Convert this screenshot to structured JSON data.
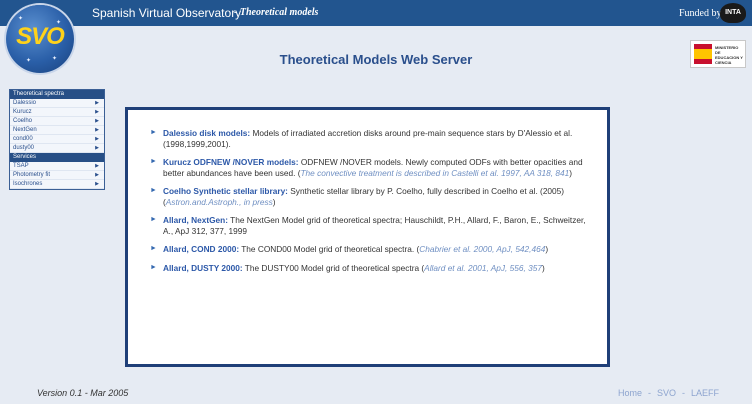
{
  "topbar": {
    "title": "Spanish Virtual Observatory",
    "subtitle": "- Theoretical models",
    "funded_by": "Funded by",
    "inta_logo": "INTA"
  },
  "logo": {
    "text": "SVO"
  },
  "header": {
    "title": "Theoretical Models Web Server"
  },
  "ministry_logo": {
    "text": "MINISTERIO DE EDUCACION Y CIENCIA"
  },
  "sidebar": {
    "sections": [
      {
        "title": "Theoretical spectra",
        "items": [
          {
            "label": "Dalessio",
            "arrow": "▶"
          },
          {
            "label": "Kurucz",
            "arrow": "▶"
          },
          {
            "label": "Coelho",
            "arrow": "▶"
          },
          {
            "label": "NextGen",
            "arrow": "▶"
          },
          {
            "label": "cond00",
            "arrow": "▶"
          },
          {
            "label": "dusty00",
            "arrow": "▶"
          }
        ]
      },
      {
        "title": "Services",
        "items": [
          {
            "label": "TSAP",
            "arrow": "▶"
          },
          {
            "label": "Photometry fit",
            "arrow": "▶"
          },
          {
            "label": "Isochrones",
            "arrow": "▶"
          }
        ]
      }
    ]
  },
  "entries": [
    {
      "title": "Dalessio disk models:",
      "text": " Models of irradiated accretion disks around pre-main sequence stars by D'Alessio et al. (1998,1999,2001).",
      "ref": "",
      "tail": ""
    },
    {
      "title": "Kurucz ODFNEW /NOVER models:",
      "text": " ODFNEW /NOVER models. Newly computed ODFs with better opacities and better abundances have been used. (",
      "ref": "The convective treatment is described in Castelli et al. 1997, AA 318, 841",
      "tail": ")"
    },
    {
      "title": "Coelho Synthetic stellar library:",
      "text": " Synthetic stellar library by P. Coelho, fully described in Coelho et al. (2005) (",
      "ref": "Astron.and.Astroph., in press",
      "tail": ")"
    },
    {
      "title": "Allard, NextGen:",
      "text": " The NextGen Model grid of theoretical spectra; Hauschildt, P.H., Allard, F., Baron, E., Schweitzer, A., ApJ 312, 377, 1999",
      "ref": "",
      "tail": ""
    },
    {
      "title": "Allard, COND 2000:",
      "text": " The COND00 Model grid of theoretical spectra. (",
      "ref": "Chabrier et al. 2000, ApJ, 542,464",
      "tail": ")"
    },
    {
      "title": "Allard, DUSTY 2000:",
      "text": " The DUSTY00 Model grid of theoretical spectra (",
      "ref": "Allard et al. 2001, ApJ, 556, 357",
      "tail": ")"
    }
  ],
  "footer": {
    "version": "Version 0.1 - Mar 2005",
    "links": [
      "Home",
      "SVO",
      "LAEFF"
    ],
    "separator": "-"
  },
  "colors": {
    "topbar": "#22558f",
    "accent": "#2c58a8",
    "background": "#e6ebf3",
    "logo_text": "#ffd21a"
  }
}
